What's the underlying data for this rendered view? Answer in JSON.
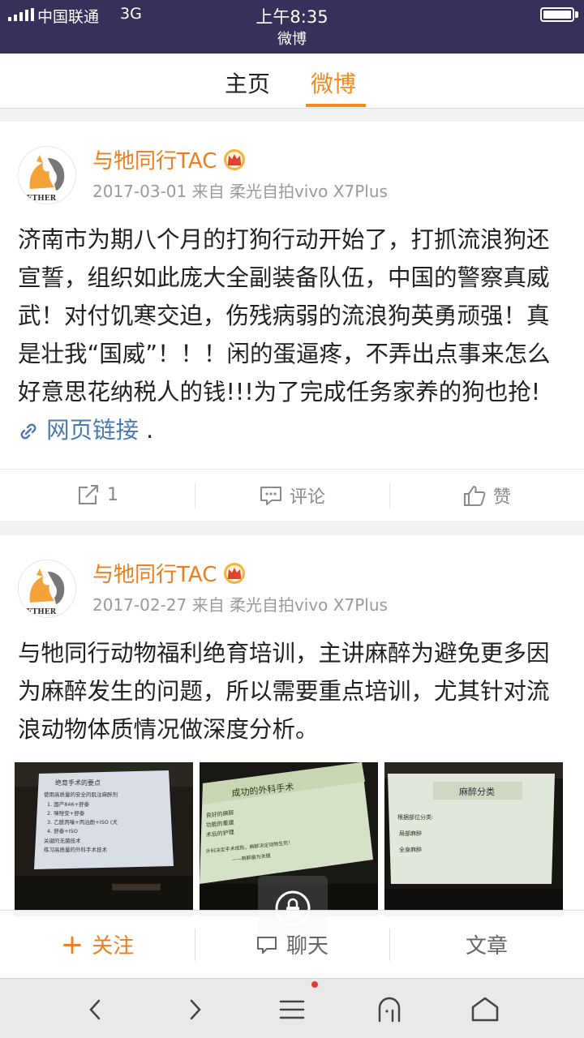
{
  "status_bar": {
    "carrier": "中国联通",
    "network": "3G",
    "time": "上午8:35",
    "app_name": "微博"
  },
  "tabs": [
    {
      "label": "主页",
      "active": false
    },
    {
      "label": "微博",
      "active": true
    }
  ],
  "posts": [
    {
      "author": "与牠同行TAC",
      "date": "2017-03-01",
      "source_prefix": "来自",
      "source": "柔光自拍vivo X7Plus",
      "text": "济南市为期八个月的打狗行动开始了，打抓流浪狗还宣誓，组织如此庞大全副装备队伍，中国的警察真威武！对付饥寒交迫，伤残病弱的流浪狗英勇顽强！真是壮我“国威”！！！闲的蛋逼疼，不弄出点事来怎么好意思花纳税人的钱!!!为了完成任务家养的狗也抢!",
      "link_label": "网页链接",
      "link_suffix": ".",
      "actions": {
        "repost": "1",
        "comment": "评论",
        "like": "赞"
      }
    },
    {
      "author": "与牠同行TAC",
      "date": "2017-02-27",
      "source_prefix": "来自",
      "source": "柔光自拍vivo X7Plus",
      "text": "与牠同行动物福利绝育培训，主讲麻醉为避免更多因为麻醉发生的问题，所以需要重点培训，尤其针对流浪动物体质情况做深度分析。",
      "images": [
        {
          "slide_lines": [
            "绝育手术的要点",
            "使用高质量的安全的肌注麻醉剂",
            "1. 国产846+舒泰",
            "2. 咪唑安+舒泰",
            "3. 乙酰丙嗪+丙泊酚+ISO (犬",
            "4. 舒泰+ISO",
            "关键的无菌技术",
            "练习高质量的外科手术技术"
          ]
        },
        {
          "slide_lines": [
            "成功的外科手术",
            "良好的麻醉",
            "功能的重建",
            "术后的护理",
            "外科决定手术成败，麻醉决定动物生死！",
            "——麻醉最为关键"
          ]
        },
        {
          "slide_lines": [
            "麻醉分类",
            "根据部位分类:",
            "局部麻醉",
            "全身麻醉"
          ]
        }
      ]
    }
  ],
  "bottom_bar": {
    "follow": "关注",
    "chat": "聊天",
    "articles": "文章"
  },
  "icons": {
    "repost": "repost-icon",
    "comment": "comment-icon",
    "like": "like-icon",
    "vip": "crown-icon",
    "lock": "lock-icon",
    "back": "back-icon",
    "forward": "forward-icon",
    "menu": "menu-icon",
    "browser_home": "browser-home-icon",
    "home": "home-icon"
  },
  "colors": {
    "status_bar": "#37305a",
    "accent": "#f07c1a",
    "link": "#4a7ab4",
    "notification_dot": "#e53a2e"
  }
}
